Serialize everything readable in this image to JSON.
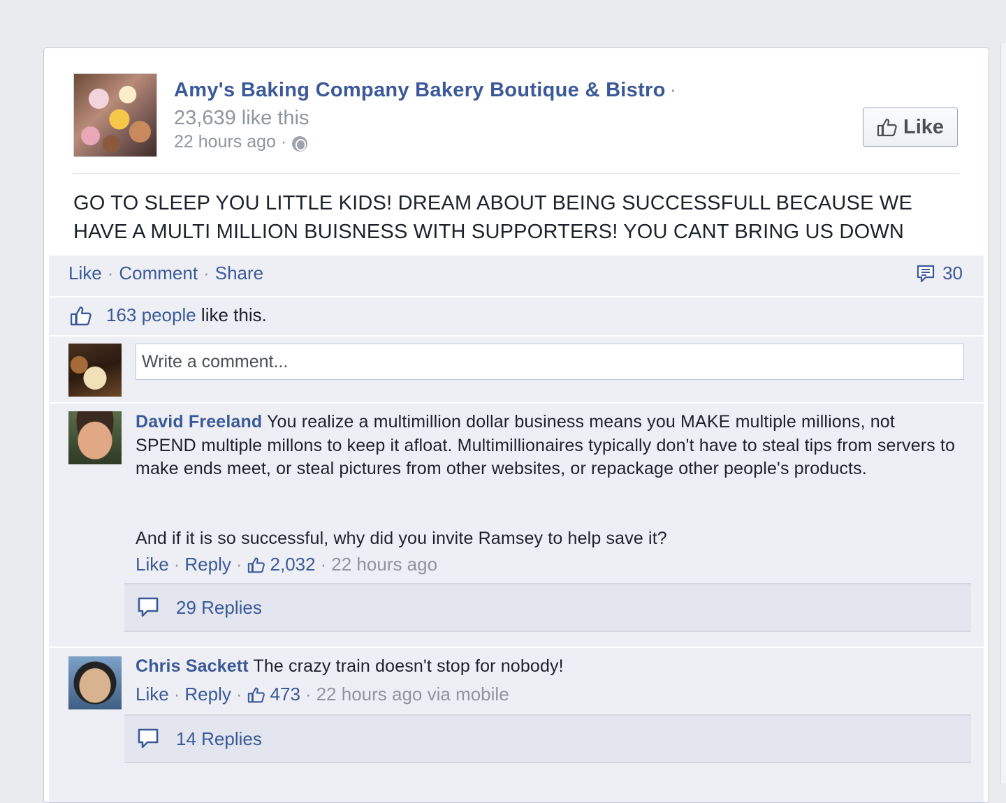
{
  "post": {
    "page_name": "Amy's Baking Company Bakery Boutique & Bistro",
    "page_name_dot": "·",
    "page_likes": "23,639 like this",
    "timestamp": "22 hours ago ·",
    "like_button_label": "Like",
    "text": "GO TO SLEEP YOU LITTLE KIDS! DREAM ABOUT BEING SUCCESSFULL BECAUSE WE HAVE A MULTI MILLION BUISNESS WITH SUPPORTERS! YOU CANT BRING US DOWN"
  },
  "actions": {
    "like": "Like",
    "comment": "Comment",
    "share": "Share",
    "sep": "·",
    "comment_count": "30"
  },
  "likes_summary": {
    "people": "163 people",
    "suffix": "like this."
  },
  "comment_box": {
    "placeholder": "Write a comment..."
  },
  "comments": [
    {
      "author": "David Freeland",
      "text_p1": "You realize a multimillion dollar business means you MAKE multiple millions, not SPEND multiple millons to keep it afloat. Multimillionaires typically don't have to steal tips from servers to make ends meet, or steal pictures from other websites, or repackage other people's products.",
      "text_p2": "And if it is so successful, why did you invite Ramsey to help save it?",
      "like": "Like",
      "reply": "Reply",
      "sep": "·",
      "likes": "2,032",
      "time": "22 hours ago",
      "replies": "29 Replies"
    },
    {
      "author": "Chris Sackett",
      "text_p1": "The crazy train doesn't stop for nobody!",
      "like": "Like",
      "reply": "Reply",
      "sep": "·",
      "likes": "473",
      "time": "22 hours ago via mobile",
      "replies": "14 Replies"
    }
  ],
  "colors": {
    "link": "#3b5998",
    "meta": "#90949c",
    "ufi_bg": "#edeff4",
    "page_bg": "#e9ebee"
  },
  "icons": [
    "globe-icon",
    "thumbs-up-icon",
    "comment-icon",
    "speech-bubble-icon"
  ]
}
